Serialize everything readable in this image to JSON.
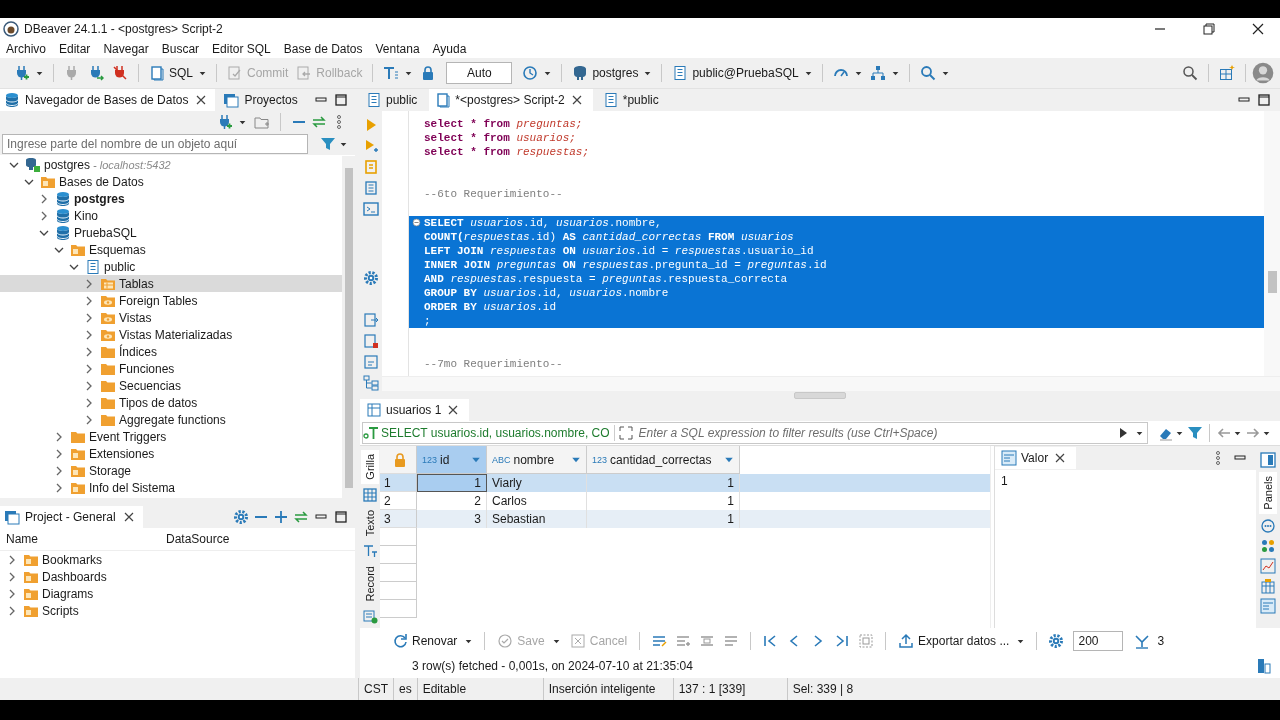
{
  "window": {
    "title": "DBeaver 24.1.1 - <postgres> Script-2"
  },
  "menu": [
    "Archivo",
    "Editar",
    "Navegar",
    "Buscar",
    "Editor SQL",
    "Base de Datos",
    "Ventana",
    "Ayuda"
  ],
  "toolbar": {
    "sql": "SQL",
    "commit": {
      "label": "Commit",
      "disabled": true
    },
    "rollback": {
      "label": "Rollback",
      "disabled": true
    },
    "transaction_mode": "Auto",
    "connection": "postgres",
    "schema": "public@PruebaSQL"
  },
  "navigator": {
    "tabs": [
      {
        "label": "Navegador de Bases de Datos",
        "selected": true
      },
      {
        "label": "Proyectos",
        "selected": false
      }
    ],
    "filter": {
      "placeholder": "Ingrese parte del nombre de un objeto aquí"
    },
    "tree": [
      {
        "label": "postgres",
        "hint": "- localhost:5432",
        "kind": "connection",
        "expanded": true,
        "selected": false,
        "bold": false,
        "children": [
          {
            "label": "Bases de Datos",
            "kind": "folder-box",
            "expanded": true,
            "selected": false,
            "bold": false,
            "children": [
              {
                "label": "postgres",
                "kind": "database",
                "expanded": false,
                "selected": false,
                "bold": true
              },
              {
                "label": "Kino",
                "kind": "database",
                "expanded": false,
                "selected": false,
                "bold": false
              },
              {
                "label": "PruebaSQL",
                "kind": "database",
                "expanded": true,
                "selected": false,
                "bold": false,
                "children": [
                  {
                    "label": "Esquemas",
                    "kind": "folder-box",
                    "expanded": true,
                    "selected": false,
                    "bold": false,
                    "children": [
                      {
                        "label": "public",
                        "kind": "schema",
                        "expanded": true,
                        "selected": false,
                        "bold": false,
                        "children": [
                          {
                            "label": "Tablas",
                            "kind": "folder-table",
                            "expanded": false,
                            "selected": true,
                            "bold": false
                          },
                          {
                            "label": "Foreign Tables",
                            "kind": "folder-view",
                            "expanded": false,
                            "selected": false,
                            "bold": false
                          },
                          {
                            "label": "Vistas",
                            "kind": "folder-view",
                            "expanded": false,
                            "selected": false,
                            "bold": false
                          },
                          {
                            "label": "Vistas Materializadas",
                            "kind": "folder-view",
                            "expanded": false,
                            "selected": false,
                            "bold": false
                          },
                          {
                            "label": "Índices",
                            "kind": "folder",
                            "expanded": false,
                            "selected": false,
                            "bold": false
                          },
                          {
                            "label": "Funciones",
                            "kind": "folder",
                            "expanded": false,
                            "selected": false,
                            "bold": false
                          },
                          {
                            "label": "Secuencias",
                            "kind": "folder",
                            "expanded": false,
                            "selected": false,
                            "bold": false
                          },
                          {
                            "label": "Tipos de datos",
                            "kind": "folder",
                            "expanded": false,
                            "selected": false,
                            "bold": false
                          },
                          {
                            "label": "Aggregate functions",
                            "kind": "folder",
                            "expanded": false,
                            "selected": false,
                            "bold": false
                          }
                        ]
                      }
                    ]
                  },
                  {
                    "label": "Event Triggers",
                    "kind": "folder",
                    "expanded": false,
                    "selected": false,
                    "bold": false
                  },
                  {
                    "label": "Extensiones",
                    "kind": "folder-box",
                    "expanded": false,
                    "selected": false,
                    "bold": false
                  },
                  {
                    "label": "Storage",
                    "kind": "folder-box",
                    "expanded": false,
                    "selected": false,
                    "bold": false
                  },
                  {
                    "label": "Info del Sistema",
                    "kind": "folder-box",
                    "expanded": false,
                    "selected": false,
                    "bold": false
                  }
                ]
              }
            ]
          }
        ]
      }
    ]
  },
  "project": {
    "tab": "Project - General",
    "columns": [
      "Name",
      "DataSource"
    ],
    "items": [
      "Bookmarks",
      "Dashboards",
      "Diagrams",
      "Scripts"
    ]
  },
  "editor": {
    "tabs": [
      {
        "label": "public",
        "selected": false
      },
      {
        "label": "*<postgres> Script-2",
        "selected": true
      },
      {
        "label": "*public",
        "selected": false
      }
    ],
    "lines": [
      {
        "kind": "code",
        "selected": false,
        "foldable": false,
        "segments": [
          {
            "text": "select * from ",
            "kind": "keyword"
          },
          {
            "text": "preguntas;",
            "kind": "table"
          }
        ]
      },
      {
        "kind": "code",
        "selected": false,
        "foldable": false,
        "segments": [
          {
            "text": "select * from ",
            "kind": "keyword"
          },
          {
            "text": "usuarios;",
            "kind": "table"
          }
        ]
      },
      {
        "kind": "code",
        "selected": false,
        "foldable": false,
        "segments": [
          {
            "text": "select * from ",
            "kind": "keyword"
          },
          {
            "text": "respuestas;",
            "kind": "table"
          }
        ]
      },
      {
        "kind": "blank"
      },
      {
        "kind": "blank"
      },
      {
        "kind": "code",
        "selected": false,
        "foldable": false,
        "segments": [
          {
            "text": "--6to Requerimiento--",
            "kind": "comment"
          }
        ]
      },
      {
        "kind": "blank"
      },
      {
        "kind": "code",
        "selected": true,
        "foldable": true,
        "segments": [
          {
            "text": "SELECT ",
            "kind": "keyword"
          },
          {
            "text": "usuarios",
            "kind": "table"
          },
          {
            "text": ".id, ",
            "kind": "text"
          },
          {
            "text": "usuarios",
            "kind": "table"
          },
          {
            "text": ".nombre,",
            "kind": "text"
          }
        ]
      },
      {
        "kind": "code",
        "selected": true,
        "foldable": false,
        "segments": [
          {
            "text": "COUNT(",
            "kind": "keyword"
          },
          {
            "text": "respuestas",
            "kind": "table"
          },
          {
            "text": ".id) ",
            "kind": "text"
          },
          {
            "text": "AS ",
            "kind": "keyword"
          },
          {
            "text": "cantidad_correctas",
            "kind": "table"
          },
          {
            "text": " FROM ",
            "kind": "keyword"
          },
          {
            "text": "usuarios",
            "kind": "table"
          }
        ]
      },
      {
        "kind": "code",
        "selected": true,
        "foldable": false,
        "segments": [
          {
            "text": "LEFT JOIN ",
            "kind": "keyword"
          },
          {
            "text": "respuestas",
            "kind": "table"
          },
          {
            "text": " ON ",
            "kind": "keyword"
          },
          {
            "text": "usuarios",
            "kind": "table"
          },
          {
            "text": ".id = ",
            "kind": "text"
          },
          {
            "text": "respuestas",
            "kind": "table"
          },
          {
            "text": ".usuario_id",
            "kind": "text"
          }
        ]
      },
      {
        "kind": "code",
        "selected": true,
        "foldable": false,
        "segments": [
          {
            "text": "INNER JOIN ",
            "kind": "keyword"
          },
          {
            "text": "preguntas",
            "kind": "table"
          },
          {
            "text": " ON ",
            "kind": "keyword"
          },
          {
            "text": "respuestas",
            "kind": "table"
          },
          {
            "text": ".pregunta_id = ",
            "kind": "text"
          },
          {
            "text": "preguntas",
            "kind": "table"
          },
          {
            "text": ".id",
            "kind": "text"
          }
        ]
      },
      {
        "kind": "code",
        "selected": true,
        "foldable": false,
        "segments": [
          {
            "text": "AND ",
            "kind": "keyword"
          },
          {
            "text": "respuestas",
            "kind": "table"
          },
          {
            "text": ".respuesta = ",
            "kind": "text"
          },
          {
            "text": "preguntas",
            "kind": "table"
          },
          {
            "text": ".respuesta_correcta",
            "kind": "text"
          }
        ]
      },
      {
        "kind": "code",
        "selected": true,
        "foldable": false,
        "segments": [
          {
            "text": "GROUP BY ",
            "kind": "keyword"
          },
          {
            "text": "usuarios",
            "kind": "table"
          },
          {
            "text": ".id, ",
            "kind": "text"
          },
          {
            "text": "usuarios",
            "kind": "table"
          },
          {
            "text": ".nombre",
            "kind": "text"
          }
        ]
      },
      {
        "kind": "code",
        "selected": true,
        "foldable": false,
        "segments": [
          {
            "text": "ORDER BY ",
            "kind": "keyword"
          },
          {
            "text": "usuarios",
            "kind": "table"
          },
          {
            "text": ".id",
            "kind": "text"
          }
        ]
      },
      {
        "kind": "code",
        "selected": true,
        "foldable": false,
        "segments": [
          {
            "text": ";",
            "kind": "text"
          }
        ]
      },
      {
        "kind": "blank"
      },
      {
        "kind": "blank"
      },
      {
        "kind": "code",
        "selected": false,
        "foldable": false,
        "segments": [
          {
            "text": "--7mo Requerimiento--",
            "kind": "comment"
          }
        ]
      }
    ]
  },
  "results": {
    "tab": "usuarios 1",
    "query": "SELECT usuarios.id, usuarios.nombre, CO",
    "filter": {
      "placeholder": "Enter a SQL expression to filter results (use Ctrl+Space)"
    },
    "views": [
      {
        "label": "Grilla",
        "selected": true
      },
      {
        "label": "Texto",
        "selected": false
      },
      {
        "label": "Record",
        "selected": false
      }
    ],
    "columns": [
      {
        "type": "123",
        "label": "id",
        "selected": true
      },
      {
        "type": "ABC",
        "label": "nombre",
        "selected": false
      },
      {
        "type": "123",
        "label": "cantidad_correctas",
        "selected": false
      }
    ],
    "rows": [
      {
        "number": "1",
        "selected": true,
        "cells": [
          "1",
          "Viarly",
          "1"
        ]
      },
      {
        "number": "2",
        "selected": false,
        "cells": [
          "2",
          "Carlos",
          "1"
        ]
      },
      {
        "number": "3",
        "selected": false,
        "cells": [
          "3",
          "Sebastian",
          "1"
        ]
      }
    ],
    "value_panel": {
      "tab": "Valor",
      "value": "1"
    },
    "side_panel": "Panels",
    "actions": {
      "refresh": "Renovar",
      "save": {
        "label": "Save",
        "disabled": true
      },
      "cancel": {
        "label": "Cancel",
        "disabled": true
      },
      "export": "Exportar datos ...",
      "fetch_size": "200",
      "row_count": "3"
    },
    "message": "3 row(s) fetched - 0,001s, on 2024-07-10 at 21:35:04"
  },
  "status_bar": [
    "CST",
    "es",
    "Editable",
    "Inserción inteligente",
    "137 : 1 [339]",
    "Sel: 339 | 8"
  ]
}
